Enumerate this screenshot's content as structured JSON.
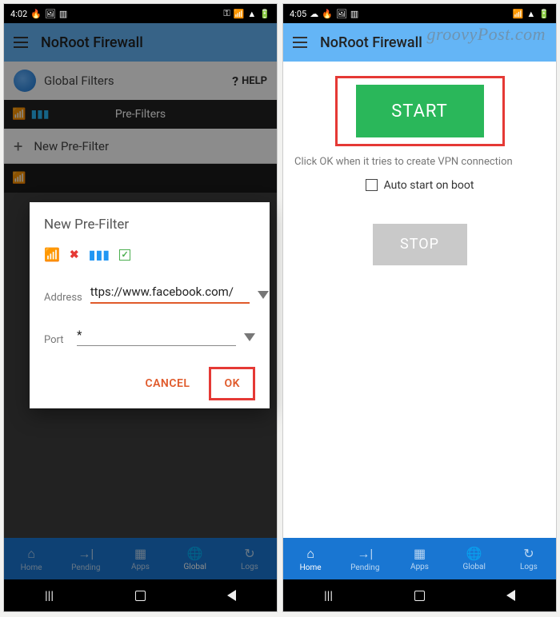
{
  "watermark": "groovyPost.com",
  "left": {
    "time": "4:02",
    "status_icons_left": [
      "▲",
      "■",
      "▥"
    ],
    "status_icons_right": [
      "⚿",
      "🔋"
    ],
    "app_title": "NoRoot Firewall",
    "subheader": "Global Filters",
    "help_label": "HELP",
    "tab_label": "Pre-Filters",
    "new_filter_label": "New Pre-Filter",
    "dialog": {
      "title": "New Pre-Filter",
      "address_label": "Address",
      "address_value": "ttps://www.facebook.com/",
      "port_label": "Port",
      "port_value": "*",
      "cancel": "CANCEL",
      "ok": "OK"
    },
    "tabs": [
      "Home",
      "Pending",
      "Apps",
      "Global",
      "Logs"
    ],
    "active_tab": 3
  },
  "right": {
    "time": "4:05",
    "status_icons_left": [
      "☁",
      "▲",
      "■",
      "▥"
    ],
    "status_icons_right": [
      "📶",
      "🔋"
    ],
    "app_title": "NoRoot Firewall",
    "start_label": "START",
    "hint": "Click OK when it tries to create VPN connection",
    "auto_label": "Auto start on boot",
    "stop_label": "STOP",
    "tabs": [
      "Home",
      "Pending",
      "Apps",
      "Global",
      "Logs"
    ],
    "active_tab": 0
  }
}
